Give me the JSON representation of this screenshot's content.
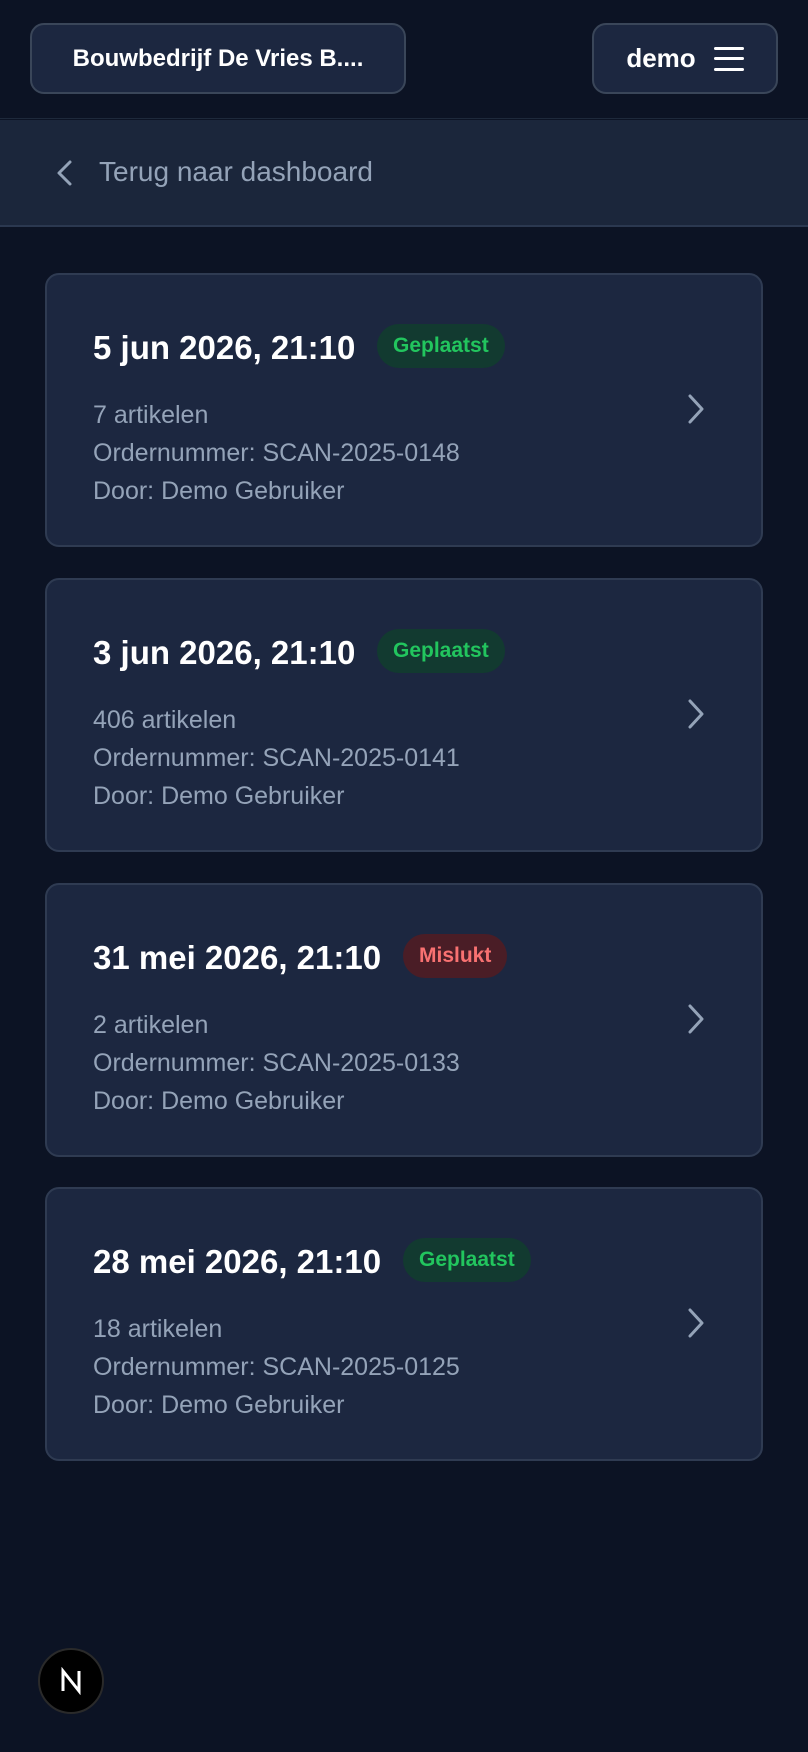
{
  "header": {
    "company_label": "Bouwbedrijf De Vries B....",
    "user_label": "demo",
    "menu_icon": "hamburger-menu-icon"
  },
  "nav": {
    "back_label": "Terug naar dashboard",
    "back_icon": "chevron-left-icon"
  },
  "orders": [
    {
      "date": "5 jun 2026, 21:10",
      "status": "Geplaatst",
      "status_type": "success",
      "articles": "7 artikelen",
      "order_number": "Ordernummer: SCAN-2025-0148",
      "by": "Door: Demo Gebruiker"
    },
    {
      "date": "3 jun 2026, 21:10",
      "status": "Geplaatst",
      "status_type": "success",
      "articles": "406 artikelen",
      "order_number": "Ordernummer: SCAN-2025-0141",
      "by": "Door: Demo Gebruiker"
    },
    {
      "date": "31 mei 2026, 21:10",
      "status": "Mislukt",
      "status_type": "error",
      "articles": "2 artikelen",
      "order_number": "Ordernummer: SCAN-2025-0133",
      "by": "Door: Demo Gebruiker"
    },
    {
      "date": "28 mei 2026, 21:10",
      "status": "Geplaatst",
      "status_type": "success",
      "articles": "18 artikelen",
      "order_number": "Ordernummer: SCAN-2025-0125",
      "by": "Door: Demo Gebruiker"
    }
  ],
  "colors": {
    "background": "#0c1324",
    "card": "#1c2740",
    "success": "#22c55e",
    "error": "#f87171",
    "muted_text": "#94a3b8"
  },
  "dev_badge": {
    "letter": "N",
    "icon": "nextjs-logo-icon"
  }
}
